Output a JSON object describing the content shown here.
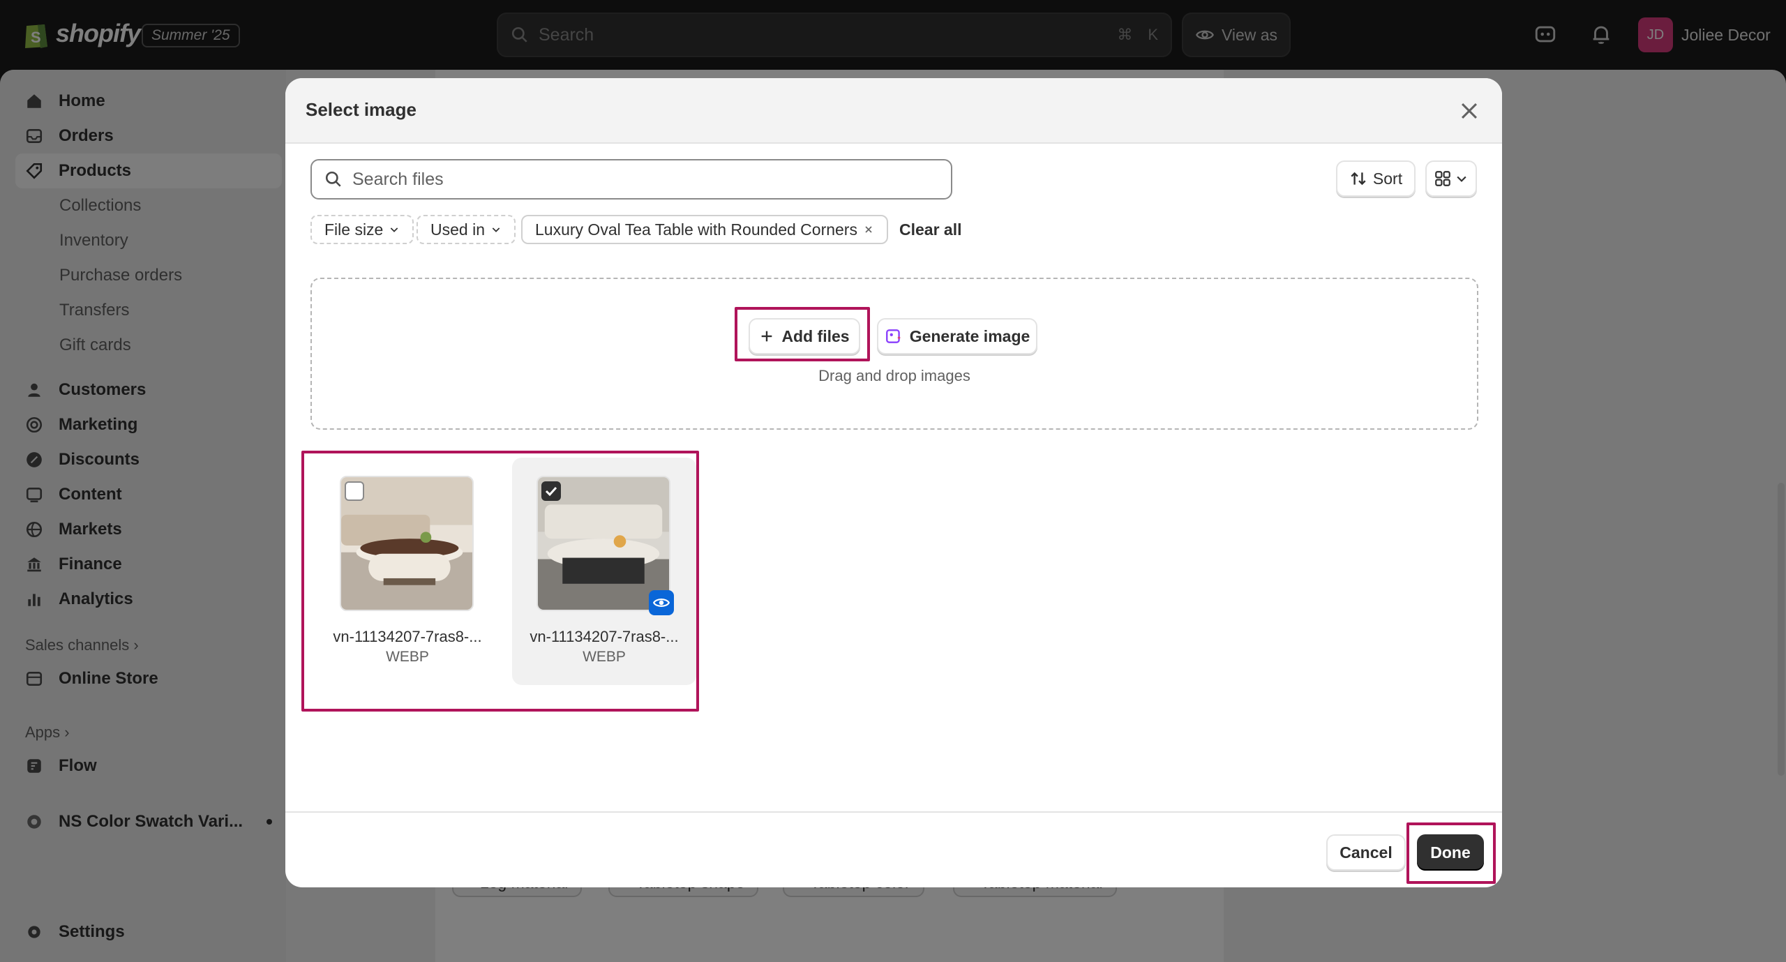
{
  "topbar": {
    "brand": "shopify",
    "edition": "Summer '25",
    "search_placeholder": "Search",
    "shortcut_cmd": "⌘",
    "shortcut_key": "K",
    "view_as": "View as",
    "store_initials": "JD",
    "store_name": "Joliee Decor"
  },
  "sidebar": {
    "items": [
      {
        "label": "Home",
        "icon": "home-icon"
      },
      {
        "label": "Orders",
        "icon": "inbox-icon"
      },
      {
        "label": "Products",
        "icon": "tag-icon"
      },
      {
        "label": "Collections"
      },
      {
        "label": "Inventory"
      },
      {
        "label": "Purchase orders"
      },
      {
        "label": "Transfers"
      },
      {
        "label": "Gift cards"
      },
      {
        "label": "Customers",
        "icon": "person-icon"
      },
      {
        "label": "Marketing",
        "icon": "target-icon"
      },
      {
        "label": "Discounts",
        "icon": "discount-icon"
      },
      {
        "label": "Content",
        "icon": "content-icon"
      },
      {
        "label": "Markets",
        "icon": "globe-icon"
      },
      {
        "label": "Finance",
        "icon": "bank-icon"
      },
      {
        "label": "Analytics",
        "icon": "chart-icon"
      },
      {
        "label": "Online Store",
        "icon": "store-icon"
      },
      {
        "label": "Flow",
        "icon": "flow-icon"
      },
      {
        "label": "NS Color Swatch Vari...",
        "icon": "app-icon"
      },
      {
        "label": "Settings",
        "icon": "gear-icon"
      }
    ],
    "sales_channels": "Sales channels",
    "apps": "Apps"
  },
  "background": {
    "chips": [
      "+ Leg material",
      "+ Tabletop shape",
      "+ Tabletop color",
      "+ Tabletop material"
    ]
  },
  "modal": {
    "title": "Select image",
    "search_placeholder": "Search files",
    "sort_label": "Sort",
    "filters": {
      "file_size": "File size",
      "used_in": "Used in",
      "applied": "Luxury Oval Tea Table with Rounded Corners",
      "clear_all": "Clear all"
    },
    "dropzone": {
      "add_files": "Add files",
      "generate_image": "Generate image",
      "hint": "Drag and drop images"
    },
    "files": [
      {
        "name": "vn-11134207-7ras8-...",
        "type": "WEBP",
        "selected": false
      },
      {
        "name": "vn-11134207-7ras8-...",
        "type": "WEBP",
        "selected": true
      }
    ],
    "cancel_label": "Cancel",
    "done_label": "Done"
  },
  "colors": {
    "accent_highlight": "#b0145a",
    "primary_button": "#303030",
    "avatar": "#d63a7d",
    "preview_badge": "#0a66d8"
  }
}
